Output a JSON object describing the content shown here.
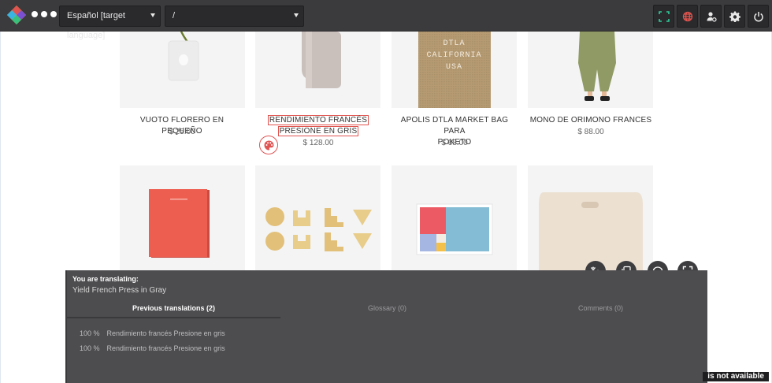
{
  "topbar": {
    "language_select": "Español [target language]",
    "path_select": "/",
    "icons": [
      "fullscreen-select-icon",
      "globe-icon",
      "user-settings-icon",
      "gear-icon",
      "power-icon"
    ]
  },
  "products": [
    {
      "title": "VUOTO FLORERO EN PEQUEÑO",
      "price": "$ 25.00"
    },
    {
      "title_line1": "RENDIMIENTO FRANCÉS",
      "title_line2": "PRESIONE EN GRIS",
      "price": "$ 128.00"
    },
    {
      "title_line1": "APOLIS DTLA MARKET BAG PARA",
      "title_line2": "POKETO",
      "price": "$ 68.00"
    },
    {
      "title": "MONO DE ORIMONO FRANCES",
      "price": "$ 88.00"
    }
  ],
  "bag_print": {
    "line1": "DTLA",
    "line2": "CALIFORNIA",
    "line3": "USA"
  },
  "panel": {
    "heading": "You are translating:",
    "source": "Yield French Press in Gray",
    "tabs": [
      "Previous translations (2)",
      "Glossary (0)",
      "Comments (0)"
    ],
    "translations": [
      {
        "pct": "100 %",
        "text": "Rendimiento francés Presione en gris"
      },
      {
        "pct": "100 %",
        "text": "Rendimiento francés Presione en gris"
      }
    ],
    "notice": "is not available"
  },
  "colors": {
    "topbar": "#3b3b3e",
    "panel": "#4d4d50",
    "highlight": "#e0544f",
    "accent_green": "#2ecc9a",
    "accent_red": "#e0544f"
  }
}
